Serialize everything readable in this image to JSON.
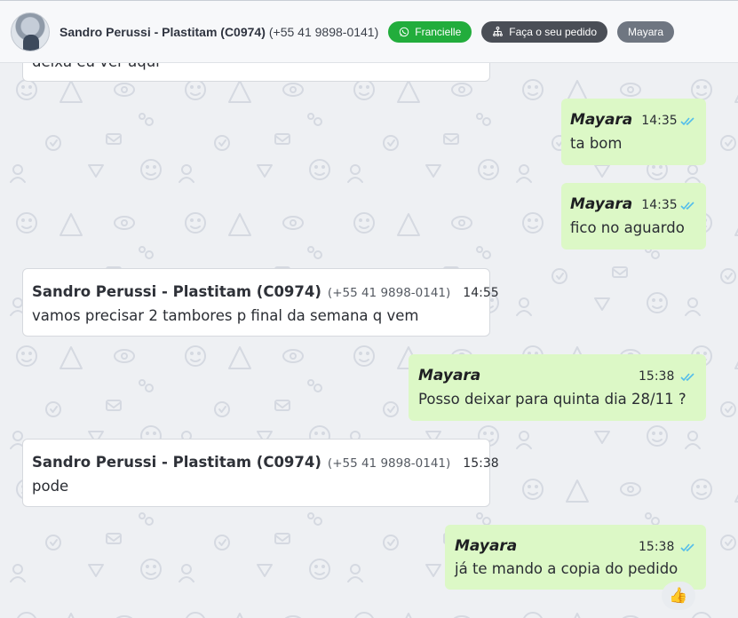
{
  "header": {
    "contact_name": "Sandro Perussi - Plastitam (C0974)",
    "contact_phone": "(+55 41 9898-0141)",
    "agent_tag": "Francielle",
    "order_button": "Faça o seu pedido",
    "user_tag": "Mayara"
  },
  "messages": [
    {
      "id": "m0",
      "direction": "in",
      "text": "deixa eu ver aqui"
    },
    {
      "id": "m1",
      "direction": "out",
      "sender": "Mayara",
      "time": "14:35",
      "text": "ta bom"
    },
    {
      "id": "m2",
      "direction": "out",
      "sender": "Mayara",
      "time": "14:35",
      "text": "fico no aguardo"
    },
    {
      "id": "m3",
      "direction": "in",
      "sender": "Sandro Perussi - Plastitam (C0974)",
      "phone": "(+55 41 9898-0141)",
      "time": "14:55",
      "text": "vamos precisar 2 tambores p final da semana q vem"
    },
    {
      "id": "m4",
      "direction": "out",
      "sender": "Mayara",
      "time": "15:38",
      "text": "Posso deixar para quinta dia 28/11 ?"
    },
    {
      "id": "m5",
      "direction": "in",
      "sender": "Sandro Perussi - Plastitam (C0974)",
      "phone": "(+55 41 9898-0141)",
      "time": "15:38",
      "text": "pode"
    },
    {
      "id": "m6",
      "direction": "out",
      "sender": "Mayara",
      "time": "15:38",
      "text": "já te mando a copia do pedido",
      "reaction": "👍"
    }
  ],
  "colors": {
    "outgoing_bubble": "#dcf8c6",
    "incoming_bubble": "#ffffff",
    "read_ticks": "#53bdeb",
    "agent_tag": "#22ad3c"
  },
  "icons": {
    "agent_tag": "whatsapp-icon",
    "order_button": "hierarchy-icon",
    "read_status": "double-check-icon"
  }
}
